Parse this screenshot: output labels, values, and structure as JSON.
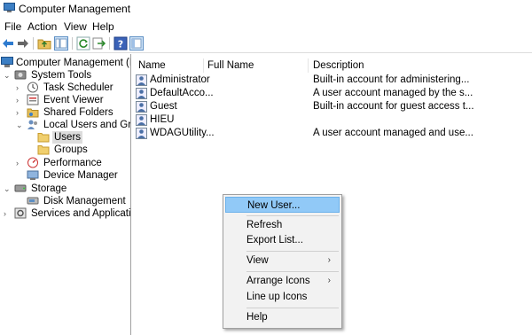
{
  "window": {
    "title": "Computer Management"
  },
  "menu": [
    "File",
    "Action",
    "View",
    "Help"
  ],
  "toolbar": {
    "icons": [
      "back-arrow-icon",
      "forward-arrow-icon",
      "up-folder-icon",
      "show-hide-tree-icon",
      "refresh-icon",
      "export-icon",
      "help-icon",
      "properties-icon"
    ]
  },
  "tree": {
    "root": "Computer Management (Local",
    "system_tools": "System Tools",
    "task_scheduler": "Task Scheduler",
    "event_viewer": "Event Viewer",
    "shared_folders": "Shared Folders",
    "local_users_groups": "Local Users and Groups",
    "users": "Users",
    "groups": "Groups",
    "performance": "Performance",
    "device_manager": "Device Manager",
    "storage": "Storage",
    "disk_management": "Disk Management",
    "services_apps": "Services and Applications"
  },
  "list": {
    "columns": {
      "name": "Name",
      "full_name": "Full Name",
      "description": "Description"
    },
    "rows": [
      {
        "name": "Administrator",
        "full_name": "",
        "description": "Built-in account for administering..."
      },
      {
        "name": "DefaultAcco...",
        "full_name": "",
        "description": "A user account managed by the s..."
      },
      {
        "name": "Guest",
        "full_name": "",
        "description": "Built-in account for guest access t..."
      },
      {
        "name": "HIEU",
        "full_name": "",
        "description": ""
      },
      {
        "name": "WDAGUtility...",
        "full_name": "",
        "description": "A user account managed and use..."
      }
    ]
  },
  "context_menu": {
    "new_user": "New User...",
    "refresh": "Refresh",
    "export_list": "Export List...",
    "view": "View",
    "arrange_icons": "Arrange Icons",
    "line_up_icons": "Line up Icons",
    "help": "Help",
    "submenu_arrow": "›"
  },
  "colors": {
    "highlight": "#91c9f7",
    "selected_tree": "#dcdcdc",
    "menu_bg": "#f2f2f2"
  }
}
